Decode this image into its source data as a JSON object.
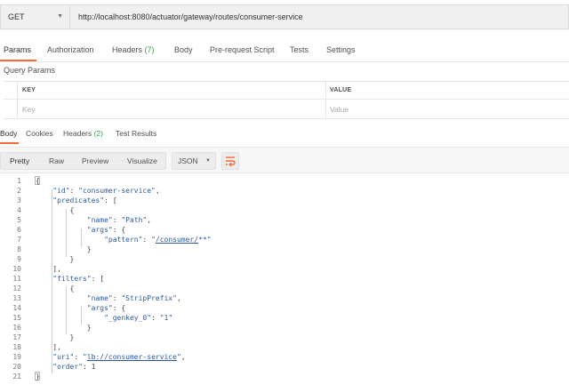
{
  "request": {
    "method": "GET",
    "url": "http://localhost:8080/actuator/gateway/routes/consumer-service"
  },
  "request_tabs": [
    {
      "label": "Params",
      "count": ""
    },
    {
      "label": "Authorization",
      "count": ""
    },
    {
      "label": "Headers",
      "count": "(7)"
    },
    {
      "label": "Body",
      "count": ""
    },
    {
      "label": "Pre-request Script",
      "count": ""
    },
    {
      "label": "Tests",
      "count": ""
    },
    {
      "label": "Settings",
      "count": ""
    }
  ],
  "query_params": {
    "title": "Query Params",
    "col_key": "KEY",
    "col_value": "VALUE",
    "key_placeholder": "Key",
    "value_placeholder": "Value"
  },
  "response_tabs": [
    {
      "label": "Body",
      "count": ""
    },
    {
      "label": "Cookies",
      "count": ""
    },
    {
      "label": "Headers",
      "count": "(2)"
    },
    {
      "label": "Test Results",
      "count": ""
    }
  ],
  "view_modes": [
    "Pretty",
    "Raw",
    "Preview",
    "Visualize"
  ],
  "format": "JSON",
  "icons": {
    "method_dropdown": "chevron-down-icon",
    "format_dropdown": "chevron-down-icon",
    "wrap": "wrap-lines-icon"
  },
  "colors": {
    "accent": "#f26b3a",
    "count": "#3e9f4a",
    "json_key": "#2c5aa0"
  },
  "code_lines": [
    {
      "n": "1",
      "tokens": [
        {
          "t": "{",
          "c": "p"
        }
      ]
    },
    {
      "n": "2",
      "tokens": [
        {
          "t": "    ",
          "c": "p"
        },
        {
          "t": "\"id\"",
          "c": "k"
        },
        {
          "t": ": ",
          "c": "p"
        },
        {
          "t": "\"consumer-service\"",
          "c": "s"
        },
        {
          "t": ",",
          "c": "p"
        }
      ]
    },
    {
      "n": "3",
      "tokens": [
        {
          "t": "    ",
          "c": "p"
        },
        {
          "t": "\"predicates\"",
          "c": "k"
        },
        {
          "t": ": [",
          "c": "p"
        }
      ]
    },
    {
      "n": "4",
      "tokens": [
        {
          "t": "        {",
          "c": "p"
        }
      ]
    },
    {
      "n": "5",
      "tokens": [
        {
          "t": "            ",
          "c": "p"
        },
        {
          "t": "\"name\"",
          "c": "k"
        },
        {
          "t": ": ",
          "c": "p"
        },
        {
          "t": "\"Path\"",
          "c": "s"
        },
        {
          "t": ",",
          "c": "p"
        }
      ]
    },
    {
      "n": "6",
      "tokens": [
        {
          "t": "            ",
          "c": "p"
        },
        {
          "t": "\"args\"",
          "c": "k"
        },
        {
          "t": ": {",
          "c": "p"
        }
      ]
    },
    {
      "n": "7",
      "tokens": [
        {
          "t": "                ",
          "c": "p"
        },
        {
          "t": "\"pattern\"",
          "c": "k"
        },
        {
          "t": ": ",
          "c": "p"
        },
        {
          "t": "\"",
          "c": "s"
        },
        {
          "t": "/consumer/",
          "c": "s ul"
        },
        {
          "t": "**\"",
          "c": "s"
        }
      ]
    },
    {
      "n": "8",
      "tokens": [
        {
          "t": "            }",
          "c": "p"
        }
      ]
    },
    {
      "n": "9",
      "tokens": [
        {
          "t": "        }",
          "c": "p"
        }
      ]
    },
    {
      "n": "10",
      "tokens": [
        {
          "t": "    ],",
          "c": "p"
        }
      ]
    },
    {
      "n": "11",
      "tokens": [
        {
          "t": "    ",
          "c": "p"
        },
        {
          "t": "\"filters\"",
          "c": "k"
        },
        {
          "t": ": [",
          "c": "p"
        }
      ]
    },
    {
      "n": "12",
      "tokens": [
        {
          "t": "        {",
          "c": "p"
        }
      ]
    },
    {
      "n": "13",
      "tokens": [
        {
          "t": "            ",
          "c": "p"
        },
        {
          "t": "\"name\"",
          "c": "k"
        },
        {
          "t": ": ",
          "c": "p"
        },
        {
          "t": "\"StripPrefix\"",
          "c": "s"
        },
        {
          "t": ",",
          "c": "p"
        }
      ]
    },
    {
      "n": "14",
      "tokens": [
        {
          "t": "            ",
          "c": "p"
        },
        {
          "t": "\"args\"",
          "c": "k"
        },
        {
          "t": ": {",
          "c": "p"
        }
      ]
    },
    {
      "n": "15",
      "tokens": [
        {
          "t": "                ",
          "c": "p"
        },
        {
          "t": "\"_genkey_0\"",
          "c": "k"
        },
        {
          "t": ": ",
          "c": "p"
        },
        {
          "t": "\"1\"",
          "c": "s"
        }
      ]
    },
    {
      "n": "16",
      "tokens": [
        {
          "t": "            }",
          "c": "p"
        }
      ]
    },
    {
      "n": "17",
      "tokens": [
        {
          "t": "        }",
          "c": "p"
        }
      ]
    },
    {
      "n": "18",
      "tokens": [
        {
          "t": "    ],",
          "c": "p"
        }
      ]
    },
    {
      "n": "19",
      "tokens": [
        {
          "t": "    ",
          "c": "p"
        },
        {
          "t": "\"uri\"",
          "c": "k"
        },
        {
          "t": ": ",
          "c": "p"
        },
        {
          "t": "\"",
          "c": "s"
        },
        {
          "t": "lb://consumer-service",
          "c": "s ul"
        },
        {
          "t": "\"",
          "c": "s"
        },
        {
          "t": ",",
          "c": "p"
        }
      ]
    },
    {
      "n": "20",
      "tokens": [
        {
          "t": "    ",
          "c": "p"
        },
        {
          "t": "\"order\"",
          "c": "k"
        },
        {
          "t": ": ",
          "c": "p"
        },
        {
          "t": "1",
          "c": "n"
        }
      ]
    },
    {
      "n": "21",
      "tokens": [
        {
          "t": "}",
          "c": "p"
        }
      ]
    }
  ]
}
